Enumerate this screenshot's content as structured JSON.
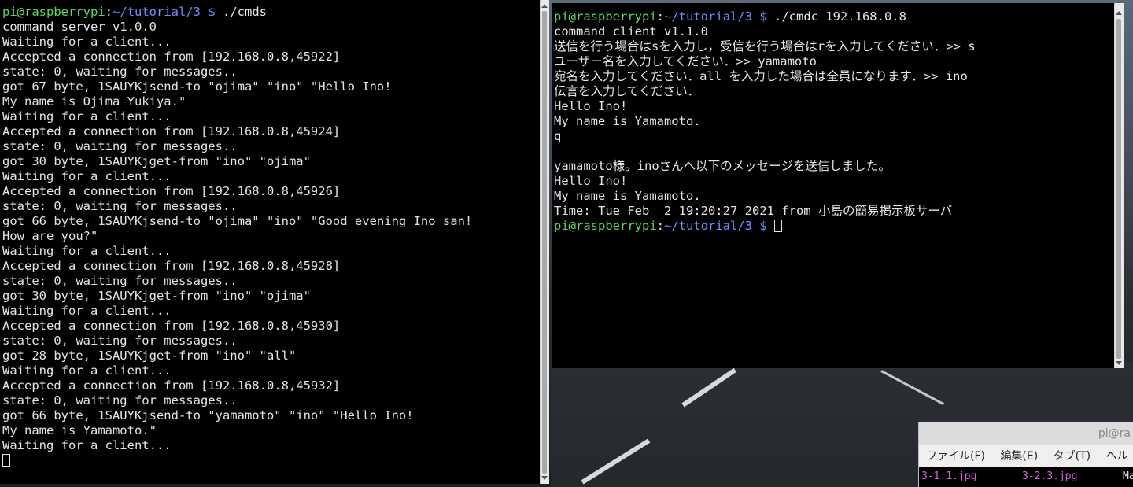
{
  "left_terminal": {
    "lines": [
      [
        {
          "t": "pi@raspberrypi",
          "c": "user"
        },
        {
          "t": ":",
          "c": "colon"
        },
        {
          "t": "~/tutorial/3 $",
          "c": "path"
        },
        {
          "t": " ./cmds",
          "c": ""
        }
      ],
      [
        {
          "t": "command server v1.0.0",
          "c": ""
        }
      ],
      [
        {
          "t": "Waiting for a client...",
          "c": ""
        }
      ],
      [
        {
          "t": "Accepted a connection from [192.168.0.8,45922]",
          "c": ""
        }
      ],
      [
        {
          "t": "state: 0, waiting for messages..",
          "c": ""
        }
      ],
      [
        {
          "t": "got 67 byte, 1SAUYKjsend-to \"ojima\" \"ino\" \"Hello Ino!",
          "c": ""
        }
      ],
      [
        {
          "t": "My name is Ojima Yukiya.\"",
          "c": ""
        }
      ],
      [
        {
          "t": "Waiting for a client...",
          "c": ""
        }
      ],
      [
        {
          "t": "Accepted a connection from [192.168.0.8,45924]",
          "c": ""
        }
      ],
      [
        {
          "t": "state: 0, waiting for messages..",
          "c": ""
        }
      ],
      [
        {
          "t": "got 30 byte, 1SAUYKjget-from \"ino\" \"ojima\"",
          "c": ""
        }
      ],
      [
        {
          "t": "Waiting for a client...",
          "c": ""
        }
      ],
      [
        {
          "t": "Accepted a connection from [192.168.0.8,45926]",
          "c": ""
        }
      ],
      [
        {
          "t": "state: 0, waiting for messages..",
          "c": ""
        }
      ],
      [
        {
          "t": "got 66 byte, 1SAUYKjsend-to \"ojima\" \"ino\" \"Good evening Ino san!",
          "c": ""
        }
      ],
      [
        {
          "t": "How are you?\"",
          "c": ""
        }
      ],
      [
        {
          "t": "Waiting for a client...",
          "c": ""
        }
      ],
      [
        {
          "t": "Accepted a connection from [192.168.0.8,45928]",
          "c": ""
        }
      ],
      [
        {
          "t": "state: 0, waiting for messages..",
          "c": ""
        }
      ],
      [
        {
          "t": "got 30 byte, 1SAUYKjget-from \"ino\" \"ojima\"",
          "c": ""
        }
      ],
      [
        {
          "t": "Waiting for a client...",
          "c": ""
        }
      ],
      [
        {
          "t": "Accepted a connection from [192.168.0.8,45930]",
          "c": ""
        }
      ],
      [
        {
          "t": "state: 0, waiting for messages..",
          "c": ""
        }
      ],
      [
        {
          "t": "got 28 byte, 1SAUYKjget-from \"ino\" \"all\"",
          "c": ""
        }
      ],
      [
        {
          "t": "Waiting for a client...",
          "c": ""
        }
      ],
      [
        {
          "t": "Accepted a connection from [192.168.0.8,45932]",
          "c": ""
        }
      ],
      [
        {
          "t": "state: 0, waiting for messages..",
          "c": ""
        }
      ],
      [
        {
          "t": "got 66 byte, 1SAUYKjsend-to \"yamamoto\" \"ino\" \"Hello Ino!",
          "c": ""
        }
      ],
      [
        {
          "t": "My name is Yamamoto.\"",
          "c": ""
        }
      ],
      [
        {
          "t": "Waiting for a client...",
          "c": ""
        }
      ],
      [
        {
          "t": "",
          "c": "cursor"
        }
      ]
    ]
  },
  "right_terminal": {
    "lines": [
      [
        {
          "t": "pi@raspberrypi",
          "c": "user"
        },
        {
          "t": ":",
          "c": "colon"
        },
        {
          "t": "~/tutorial/3 $",
          "c": "path"
        },
        {
          "t": " ./cmdc 192.168.0.8",
          "c": ""
        }
      ],
      [
        {
          "t": "command client v1.1.0",
          "c": ""
        }
      ],
      [
        {
          "t": "送信を行う場合はsを入力し，受信を行う場合はrを入力してください．>> s",
          "c": ""
        }
      ],
      [
        {
          "t": "ユーザー名を入力してください．>> yamamoto",
          "c": ""
        }
      ],
      [
        {
          "t": "宛名を入力してください．all を入力した場合は全員になります．>> ino",
          "c": ""
        }
      ],
      [
        {
          "t": "伝言を入力してください．",
          "c": ""
        }
      ],
      [
        {
          "t": "Hello Ino!",
          "c": ""
        }
      ],
      [
        {
          "t": "My name is Yamamoto.",
          "c": ""
        }
      ],
      [
        {
          "t": "q",
          "c": ""
        }
      ],
      [
        {
          "t": "",
          "c": ""
        }
      ],
      [
        {
          "t": "yamamoto様。inoさんへ以下のメッセージを送信しました。",
          "c": ""
        }
      ],
      [
        {
          "t": "Hello Ino!",
          "c": ""
        }
      ],
      [
        {
          "t": "My name is Yamamoto.",
          "c": ""
        }
      ],
      [
        {
          "t": "Time: Tue Feb  2 19:20:27 2021 from 小島の簡易掲示板サーバ",
          "c": ""
        }
      ],
      [
        {
          "t": "pi@raspberrypi",
          "c": "user"
        },
        {
          "t": ":",
          "c": "colon"
        },
        {
          "t": "~/tutorial/3 $",
          "c": "path"
        },
        {
          "t": " ",
          "c": ""
        },
        {
          "t": "",
          "c": "cursor"
        }
      ]
    ]
  },
  "file_manager": {
    "title": "pi@ra",
    "menu": [
      "ファイル(F)",
      "編集(E)",
      "タブ(T)",
      "ヘル"
    ],
    "files": [
      "3-1.1.jpg",
      "3-2.3.jpg",
      "Ma"
    ]
  },
  "colors": {
    "prompt_user": "#5fd35f",
    "prompt_path": "#6f8dff",
    "terminal_bg": "#000000",
    "terminal_fg": "#e5e5e5",
    "file_jpg": "#e060e0"
  }
}
